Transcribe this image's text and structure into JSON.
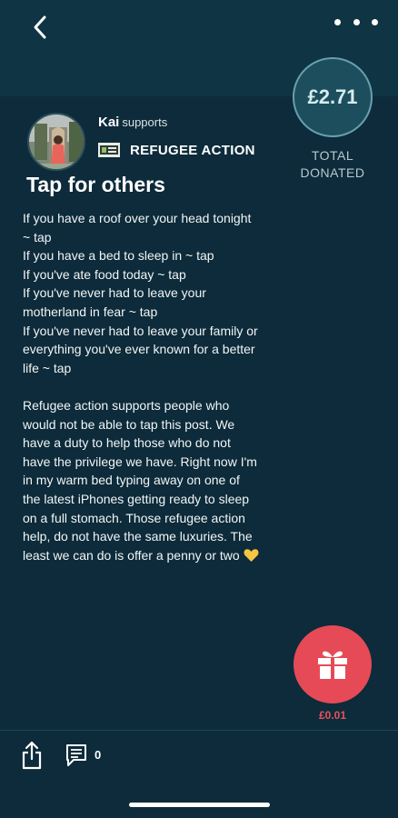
{
  "header": {
    "back_icon": "chevron-left-icon",
    "more_icon": "more-dots-icon"
  },
  "donation": {
    "total_amount": "£2.71",
    "total_label": "TOTAL\nDONATED"
  },
  "post": {
    "author_name": "Kai",
    "author_verb": "supports",
    "charity_name": "REFUGEE ACTION",
    "title": "Tap for others",
    "body": "If you have a roof over your head tonight\n~ tap\nIf you have a bed to sleep in ~ tap\nIf you've ate food today ~ tap\nIf you've never had to leave your\nmotherland in fear ~ tap\nIf you've never had to leave your family or\neverything you've ever known for a better\nlife ~ tap\n\nRefugee action supports people who\nwould not be able to tap this post. We\nhave a duty to help those who do not\nhave the privilege we have. Right now I'm\nin my warm bed typing away on one of\nthe latest iPhones getting ready to sleep\non a full stomach. Those refugee action\nhelp, do not have the same luxuries. The\nleast we can do is offer a penny or two"
  },
  "gift": {
    "amount": "£0.01",
    "icon": "gift-icon"
  },
  "footer": {
    "comment_count": "0",
    "share_icon": "share-icon",
    "comment_icon": "comment-icon"
  },
  "colors": {
    "background": "#0d2b3a",
    "header": "#0f3444",
    "accent_red": "#e64a57",
    "circle": "#1c4e5e",
    "heart": "#f5c542"
  }
}
